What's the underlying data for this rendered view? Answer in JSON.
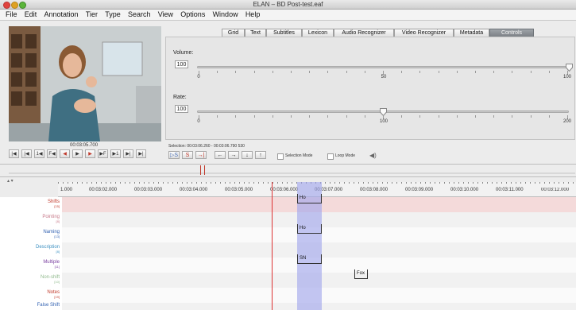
{
  "window": {
    "title": "ELAN – BD Post-test.eaf"
  },
  "menu": [
    "File",
    "Edit",
    "Annotation",
    "Tier",
    "Type",
    "Search",
    "View",
    "Options",
    "Window",
    "Help"
  ],
  "tabs": [
    {
      "label": "Grid",
      "active": false
    },
    {
      "label": "Text",
      "active": false
    },
    {
      "label": "Subtitles",
      "active": false
    },
    {
      "label": "Lexicon",
      "active": false
    },
    {
      "label": "Audio Recognizer",
      "active": false
    },
    {
      "label": "Video Recognizer",
      "active": false
    },
    {
      "label": "Metadata",
      "active": false
    },
    {
      "label": "Controls",
      "active": true
    }
  ],
  "controls": {
    "volume": {
      "label": "Volume:",
      "value": "100",
      "min": "0",
      "mid": "50",
      "max": "100",
      "level": 1.0
    },
    "rate": {
      "label": "Rate:",
      "value": "100",
      "min": "0",
      "mid": "100",
      "max": "200",
      "level": 0.5
    }
  },
  "media": {
    "time": "00:03:05.700",
    "buttons": [
      "|◀",
      "|◀",
      "1◀",
      "F◀",
      "◀",
      "▶",
      "▶",
      "▶F",
      "▶1",
      "▶|",
      "▶|"
    ]
  },
  "selection": {
    "text": "Selection: 00:03:06.260 - 00:03:06.790  530",
    "buttons": [
      "▷S",
      "S",
      "→|",
      "←",
      "→",
      "↓",
      "↑"
    ],
    "selection_mode": "Selection Mode",
    "loop_mode": "Loop Mode"
  },
  "ruler": {
    "labels": [
      "1.000",
      "00:03:02.000",
      "00:03:03.000",
      "00:03:04.000",
      "00:03:05.000",
      "00:03:06.000",
      "00:03:07.000",
      "00:03:08.000",
      "00:03:09.000",
      "00:03:10.000",
      "00:03:11.000",
      "00:03:12.000"
    ]
  },
  "tiers": [
    {
      "name": "Shifts",
      "count": "[15]",
      "color": "#c0392b",
      "highlight": true
    },
    {
      "name": "Pointing",
      "count": "[8]",
      "color": "#c77a8a",
      "highlight": false
    },
    {
      "name": "Naming",
      "count": "[13]",
      "color": "#2f5fb0",
      "highlight": false
    },
    {
      "name": "Description",
      "count": "[8]",
      "color": "#3b8fc0",
      "highlight": false
    },
    {
      "name": "Multiple",
      "count": "[11]",
      "color": "#7a3fa0",
      "highlight": false
    },
    {
      "name": "Non-shift",
      "count": "[10]",
      "color": "#8fb98b",
      "highlight": false
    },
    {
      "name": "Notes",
      "count": "[19]",
      "color": "#c0392b",
      "highlight": false
    },
    {
      "name": "False Shift",
      "count": "",
      "color": "#2f5fb0",
      "highlight": false
    }
  ],
  "annotations": {
    "shifts": "Ho",
    "naming": "Ho",
    "multiple": "SN",
    "nonshift": "Fox"
  }
}
